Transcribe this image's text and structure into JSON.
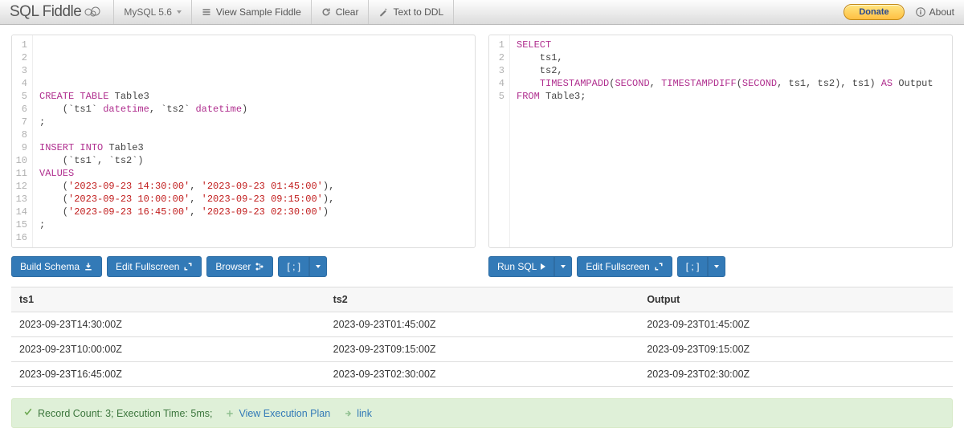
{
  "header": {
    "brand": "SQL Fiddle",
    "db_engine": "MySQL 5.6",
    "view_sample": "View Sample Fiddle",
    "clear": "Clear",
    "text_to_ddl": "Text to DDL",
    "donate": "Donate",
    "about": "About"
  },
  "schema_editor": {
    "lines": [
      "",
      "",
      "",
      "",
      "CREATE TABLE Table3",
      "    (`ts1` datetime, `ts2` datetime)",
      ";",
      "",
      "INSERT INTO Table3",
      "    (`ts1`, `ts2`)",
      "VALUES",
      "    ('2023-09-23 14:30:00', '2023-09-23 01:45:00'),",
      "    ('2023-09-23 10:00:00', '2023-09-23 09:15:00'),",
      "    ('2023-09-23 16:45:00', '2023-09-23 02:30:00')",
      ";",
      ""
    ],
    "buttons": {
      "build_schema": "Build Schema",
      "edit_fullscreen": "Edit Fullscreen",
      "browser": "Browser",
      "terminator": "[ ; ]"
    }
  },
  "query_editor": {
    "lines": [
      "SELECT",
      "    ts1,",
      "    ts2,",
      "    TIMESTAMPADD(SECOND, TIMESTAMPDIFF(SECOND, ts1, ts2), ts1) AS Output",
      "FROM Table3;"
    ],
    "buttons": {
      "run_sql": "Run SQL",
      "edit_fullscreen": "Edit Fullscreen",
      "terminator": "[ ; ]"
    }
  },
  "results": {
    "columns": [
      "ts1",
      "ts2",
      "Output"
    ],
    "rows": [
      [
        "2023-09-23T14:30:00Z",
        "2023-09-23T01:45:00Z",
        "2023-09-23T01:45:00Z"
      ],
      [
        "2023-09-23T10:00:00Z",
        "2023-09-23T09:15:00Z",
        "2023-09-23T09:15:00Z"
      ],
      [
        "2023-09-23T16:45:00Z",
        "2023-09-23T02:30:00Z",
        "2023-09-23T02:30:00Z"
      ]
    ]
  },
  "status": {
    "summary": "Record Count: 3; Execution Time: 5ms;",
    "view_plan": "View Execution Plan",
    "link": "link"
  }
}
